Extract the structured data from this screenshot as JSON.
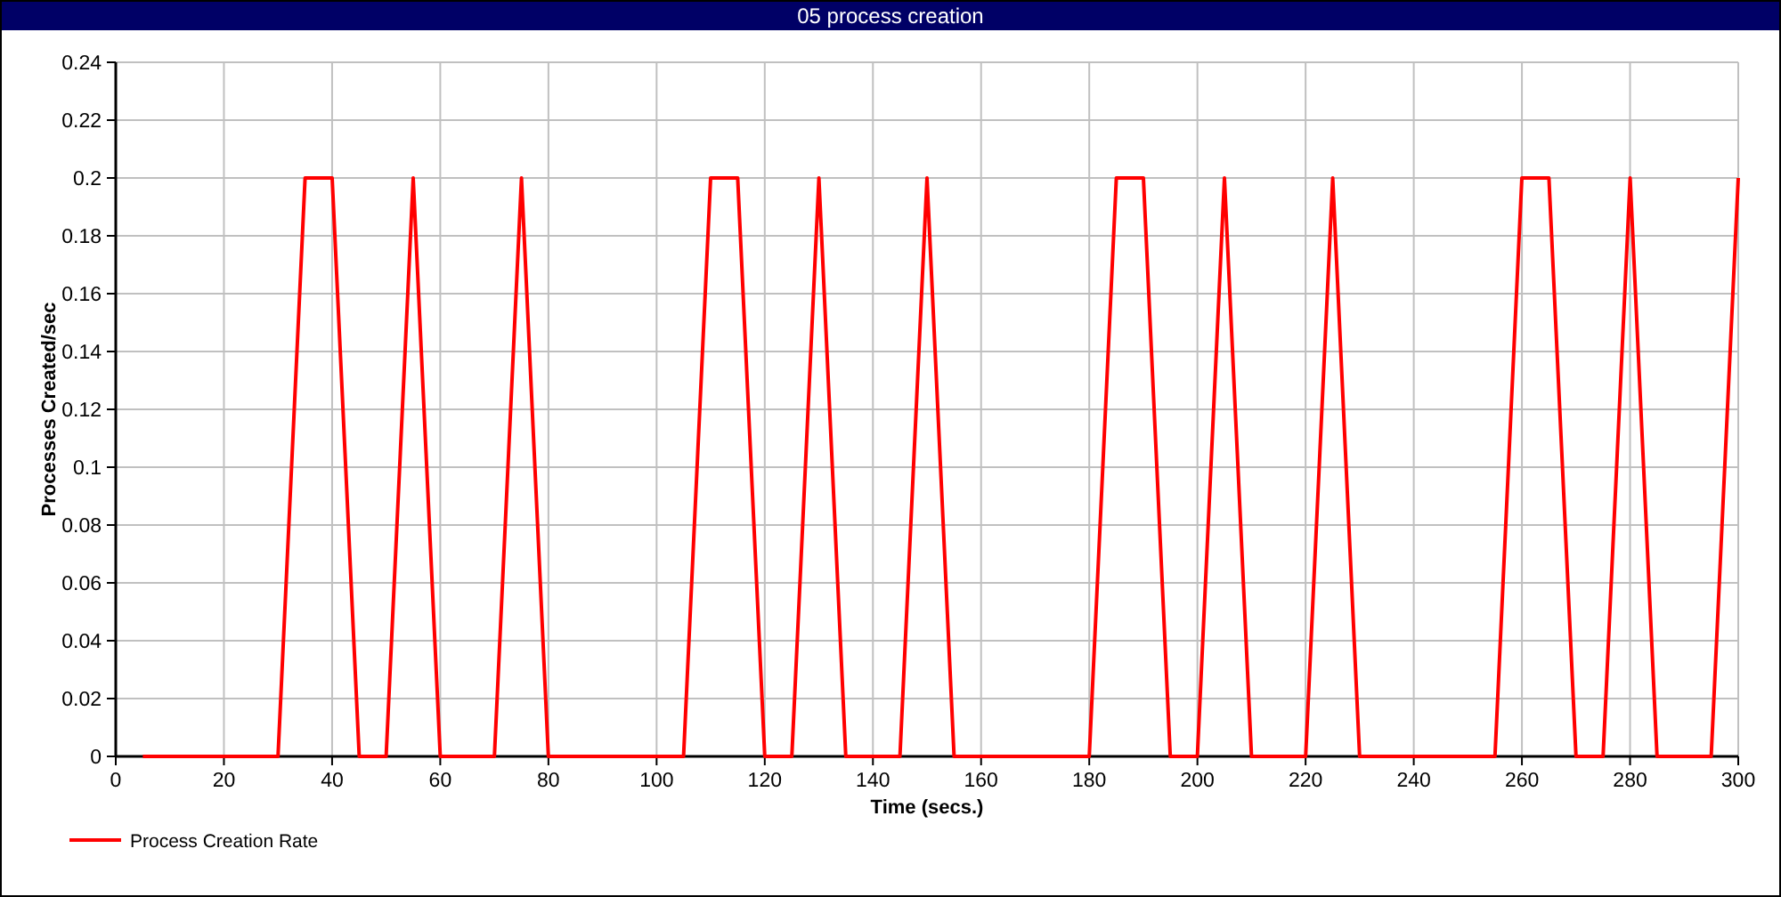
{
  "window": {
    "title": "05 process creation"
  },
  "chart": {
    "chart_data": {
      "type": "line",
      "xlabel": "Time (secs.)",
      "ylabel": "Processes Created/sec",
      "x": [
        5,
        10,
        15,
        20,
        25,
        30,
        35,
        40,
        45,
        50,
        55,
        60,
        65,
        70,
        75,
        80,
        85,
        90,
        95,
        100,
        105,
        110,
        115,
        120,
        125,
        130,
        135,
        140,
        145,
        150,
        155,
        160,
        165,
        170,
        175,
        180,
        185,
        190,
        195,
        200,
        205,
        210,
        215,
        220,
        225,
        230,
        235,
        240,
        245,
        250,
        255,
        260,
        265,
        270,
        275,
        280,
        285,
        290,
        295,
        300
      ],
      "series": [
        {
          "name": "Process Creation Rate",
          "color": "#ff0000",
          "values": [
            0,
            0,
            0,
            0,
            0,
            0,
            0.2,
            0.2,
            0,
            0,
            0.2,
            0,
            0,
            0,
            0.2,
            0,
            0,
            0,
            0,
            0,
            0,
            0.2,
            0.2,
            0,
            0,
            0.2,
            0,
            0,
            0,
            0.2,
            0,
            0,
            0,
            0,
            0,
            0,
            0.2,
            0.2,
            0,
            0,
            0.2,
            0,
            0,
            0,
            0.2,
            0,
            0,
            0,
            0,
            0,
            0,
            0.2,
            0.2,
            0,
            0,
            0.2,
            0,
            0,
            0,
            0.2
          ]
        }
      ],
      "xlim": [
        0,
        300
      ],
      "ylim": [
        0,
        0.24
      ],
      "xticks": [
        0,
        20,
        40,
        60,
        80,
        100,
        120,
        140,
        160,
        180,
        200,
        220,
        240,
        260,
        280,
        300
      ],
      "yticks": [
        0,
        0.02,
        0.04,
        0.06,
        0.08,
        0.1,
        0.12,
        0.14,
        0.16,
        0.18,
        0.2,
        0.22,
        0.24
      ],
      "grid": true
    }
  }
}
